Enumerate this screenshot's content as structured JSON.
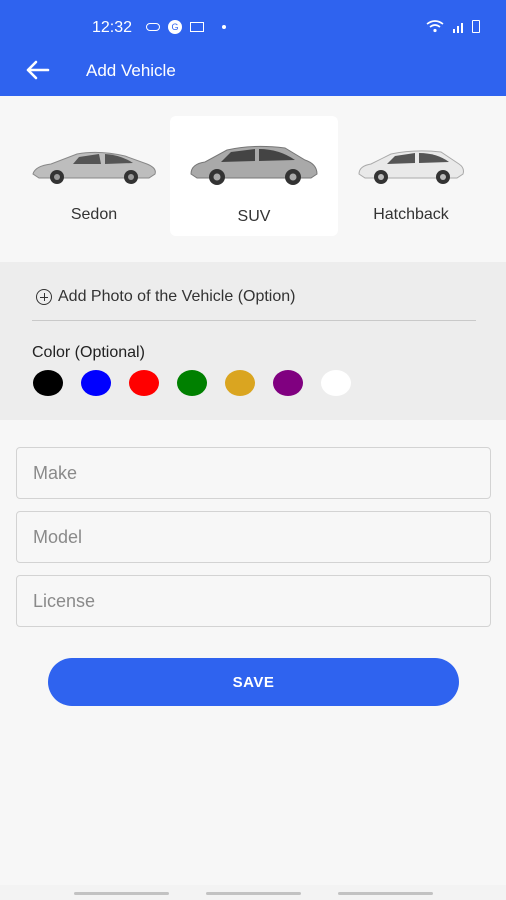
{
  "status_bar": {
    "time": "12:32",
    "google_letter": "G"
  },
  "app_bar": {
    "title": "Add Vehicle"
  },
  "vehicle_types": [
    {
      "label": "Sedon",
      "selected": false,
      "color": "#bdbdbd"
    },
    {
      "label": "SUV",
      "selected": true,
      "color": "#a9a9a9"
    },
    {
      "label": "Hatchback",
      "selected": false,
      "color": "#e9e9e9"
    }
  ],
  "options": {
    "add_photo_label": "Add Photo of the Vehicle (Option)",
    "color_label": "Color (Optional)",
    "colors": [
      "#000000",
      "#0000ff",
      "#ff0000",
      "#008000",
      "#daa520",
      "#800080",
      "#ffffff"
    ]
  },
  "form": {
    "make_placeholder": "Make",
    "model_placeholder": "Model",
    "license_placeholder": "License"
  },
  "save_label": "SAVE",
  "theme": {
    "primary": "#2f63ef"
  }
}
